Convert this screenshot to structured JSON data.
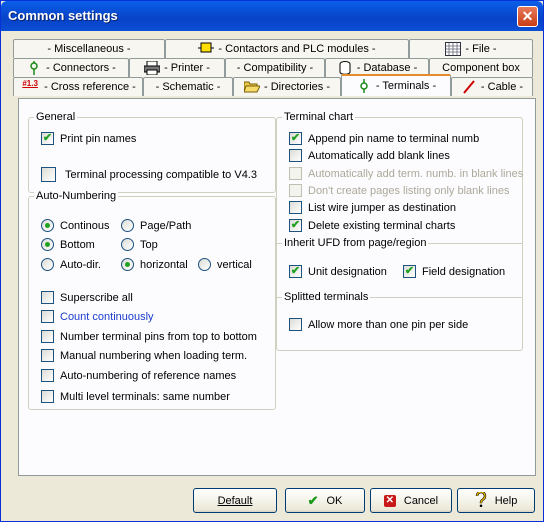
{
  "window": {
    "title": "Common settings",
    "close_glyph": "✕"
  },
  "tabs": {
    "row1": [
      "- Miscellaneous -",
      "- Contactors and PLC modules -",
      "- File -"
    ],
    "row2": [
      "- Connectors -",
      "- Printer -",
      "- Compatibility -",
      "- Database -",
      "Component box"
    ],
    "row3": [
      "- Cross reference -",
      "- Schematic -",
      "- Directories -",
      "- Terminals -",
      "- Cable -"
    ],
    "selected": "- Terminals -",
    "icon_xref_text": "#1.3"
  },
  "general": {
    "label": "General",
    "print_pin_names": {
      "label": "Print pin names",
      "checked": true
    },
    "v43": {
      "label": "Terminal processing compatible to V4.3",
      "checked": false
    }
  },
  "auto_numbering": {
    "label": "Auto-Numbering",
    "continous": "Continous",
    "page_path": "Page/Path",
    "bottom": "Bottom",
    "top": "Top",
    "auto_dir": "Auto-dir.",
    "horizontal": "horizontal",
    "vertical": "vertical",
    "superscribe_all": "Superscribe all",
    "count_continuously": "Count continuously",
    "number_top_bottom": "Number terminal pins from top to bottom",
    "manual_numbering": "Manual numbering when loading term.",
    "auto_ref_names": "Auto-numbering of reference names",
    "multi_level": "Multi level terminals: same number"
  },
  "terminal_chart": {
    "label": "Terminal chart",
    "append_pin": {
      "label": "Append pin name to terminal numb",
      "checked": true
    },
    "blank_lines": {
      "label": "Automatically add blank lines",
      "checked": false
    },
    "term_numb_blank": {
      "label": "Automatically add term. numb. in blank lines",
      "checked": false
    },
    "dont_create": {
      "label": "Don't create pages listing only blank lines",
      "checked": false
    },
    "wire_jumper": {
      "label": "List wire jumper as destination",
      "checked": false
    },
    "delete_existing": {
      "label": "Delete existing terminal charts",
      "checked": true
    }
  },
  "inherit": {
    "label": "Inherit UFD from page/region",
    "unit": {
      "label": "Unit designation",
      "checked": true
    },
    "field": {
      "label": "Field designation",
      "checked": true
    }
  },
  "splitted": {
    "label": "Splitted terminals",
    "allow_more": {
      "label": "Allow more than one pin per side",
      "checked": false
    }
  },
  "buttons": {
    "default": "Default",
    "ok": "OK",
    "cancel": "Cancel",
    "help": "Help"
  },
  "check_glyph": "✔"
}
